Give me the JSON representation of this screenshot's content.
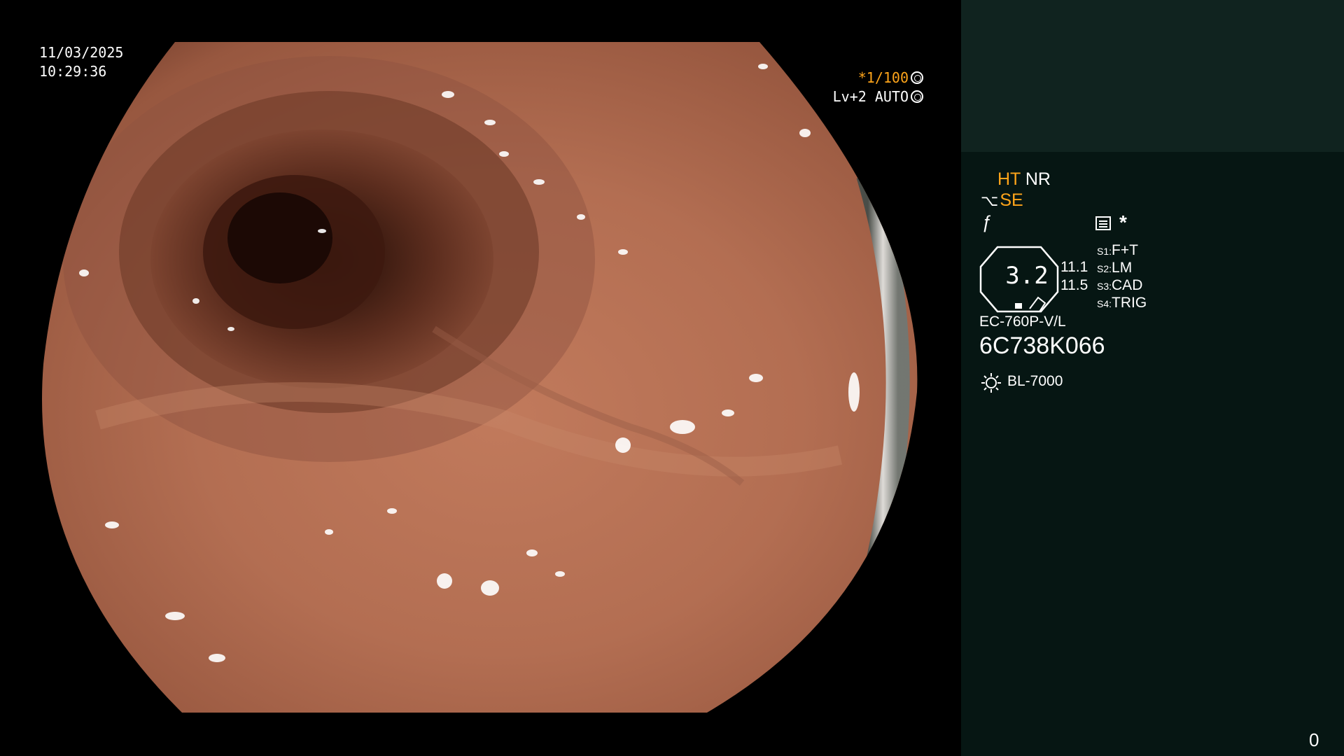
{
  "overlay": {
    "date": "11/03/2025",
    "time": "10:29:36",
    "shutter": "*1/100",
    "level": "Lv+2 AUTO"
  },
  "panel": {
    "ht": "HT",
    "nr": "NR",
    "se": "SE",
    "scope_value": "3.2",
    "value1": "11.1",
    "value2": "11.5",
    "switches": [
      {
        "key": "S1:",
        "label": "F+T"
      },
      {
        "key": "S2:",
        "label": "LM"
      },
      {
        "key": "S3:",
        "label": "CAD"
      },
      {
        "key": "S4:",
        "label": "TRIG"
      }
    ],
    "model": "EC-760P-V/L",
    "serial": "6C738K066",
    "light_source": "BL-7000",
    "counter": "0"
  },
  "colors": {
    "mucosa": "#b07054",
    "lumen": "#2a120a",
    "highlight_orange": "#ffa51a",
    "panel_bg": "#061613",
    "panel_top_bg": "#10231f"
  },
  "icons": [
    "shutter-icon",
    "level-icon",
    "edge-symbol-icon",
    "f-symbol-icon",
    "memo-icon",
    "lamp-icon"
  ]
}
